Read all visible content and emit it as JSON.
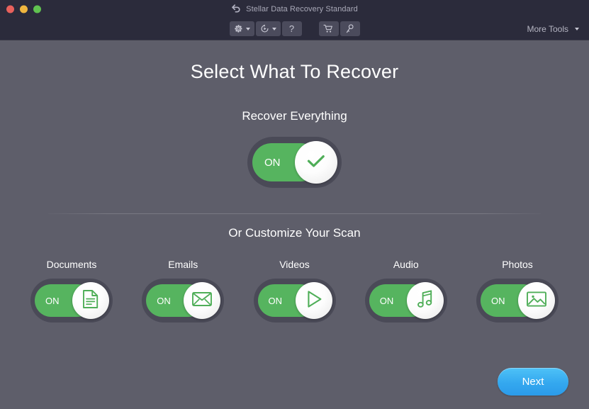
{
  "window": {
    "title": "Stellar Data Recovery Standard",
    "back_icon": "back-arrow-icon",
    "traffic_lights": [
      {
        "name": "close",
        "color": "#e8615c"
      },
      {
        "name": "minimize",
        "color": "#f0b63f"
      },
      {
        "name": "zoom",
        "color": "#60c250"
      }
    ]
  },
  "toolbar": {
    "settings_icon": "gear-icon",
    "settings_caret": "chevron-down-icon",
    "resume_icon": "resume-scan-icon",
    "resume_caret": "chevron-down-icon",
    "help_label": "?",
    "cart_icon": "shopping-cart-icon",
    "activate_icon": "key-icon",
    "more_tools_label": "More Tools",
    "more_tools_caret": "chevron-down-icon"
  },
  "main": {
    "page_title": "Select What To Recover",
    "section_title": "Recover Everything",
    "customize_title": "Or Customize Your Scan",
    "master_toggle": {
      "state_label": "ON",
      "state": "on",
      "icon": "check-icon"
    },
    "categories": [
      {
        "label": "Documents",
        "state_label": "ON",
        "state": "on",
        "icon": "document-icon"
      },
      {
        "label": "Emails",
        "state_label": "ON",
        "state": "on",
        "icon": "envelope-icon"
      },
      {
        "label": "Videos",
        "state_label": "ON",
        "state": "on",
        "icon": "play-icon"
      },
      {
        "label": "Audio",
        "state_label": "ON",
        "state": "on",
        "icon": "music-note-icon"
      },
      {
        "label": "Photos",
        "state_label": "ON",
        "state": "on",
        "icon": "photo-icon"
      }
    ],
    "next_label": "Next"
  },
  "colors": {
    "header_bg": "#2b2b3b",
    "content_bg": "#5e5e6a",
    "toggle_track": "#4a4a57",
    "toggle_on": "#56b45f",
    "accent_green": "#4fae58",
    "next_blue": "#34a8ef",
    "text_primary": "#ffffff",
    "text_muted": "#a9a9b8"
  }
}
